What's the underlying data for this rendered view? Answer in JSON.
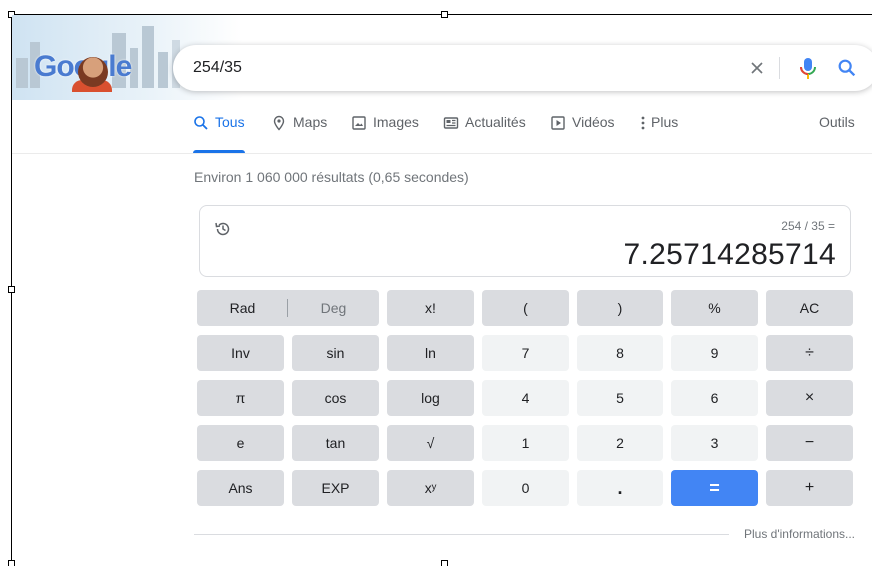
{
  "search": {
    "query": "254/35"
  },
  "logo": {
    "text": "Google"
  },
  "tabs": [
    {
      "label": "Tous",
      "icon": "search-icon",
      "active": true
    },
    {
      "label": "Maps",
      "icon": "map-pin-icon",
      "active": false
    },
    {
      "label": "Images",
      "icon": "image-icon",
      "active": false
    },
    {
      "label": "Actualités",
      "icon": "news-icon",
      "active": false
    },
    {
      "label": "Vidéos",
      "icon": "play-icon",
      "active": false
    },
    {
      "label": "Plus",
      "icon": "more-vert-icon",
      "active": false
    }
  ],
  "tools_label": "Outils",
  "result_stats": "Environ 1 060 000 résultats (0,65 secondes)",
  "calculator": {
    "expression": "254 / 35 =",
    "result": "7.25714285714",
    "rad_label": "Rad",
    "deg_label": "Deg",
    "keys": {
      "factorial": "x!",
      "open_paren": "(",
      "close_paren": ")",
      "percent": "%",
      "clear": "AC",
      "inv": "Inv",
      "sin": "sin",
      "ln": "ln",
      "seven": "7",
      "eight": "8",
      "nine": "9",
      "divide": "÷",
      "pi": "π",
      "cos": "cos",
      "log": "log",
      "four": "4",
      "five": "5",
      "six": "6",
      "multiply": "×",
      "e": "e",
      "tan": "tan",
      "sqrt": "√",
      "one": "1",
      "two": "2",
      "three": "3",
      "minus": "−",
      "ans": "Ans",
      "exp": "EXP",
      "power": "xʸ",
      "zero": "0",
      "dot": ".",
      "equals": "=",
      "plus": "+"
    }
  },
  "more_info": "Plus d'informations...",
  "colors": {
    "accent": "#1a73e8",
    "equals_button": "#4285f4",
    "function_key": "#dadce0",
    "number_key": "#f1f3f4"
  }
}
